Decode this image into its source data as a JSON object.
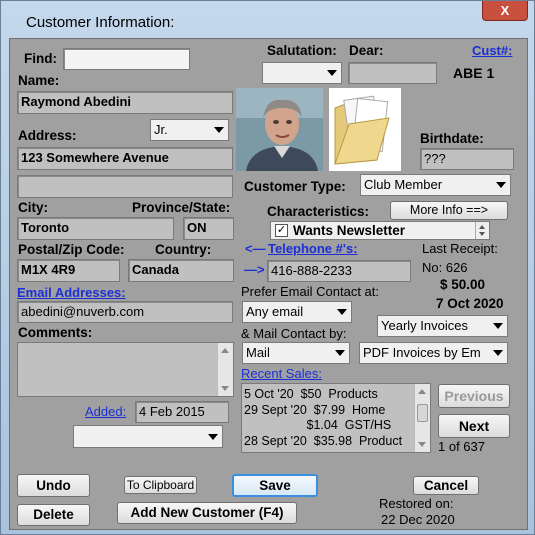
{
  "window": {
    "title": "Customer Information:",
    "close_glyph": "X"
  },
  "find": {
    "label": "Find:",
    "value": ""
  },
  "salutation": {
    "label": "Salutation:",
    "value": ""
  },
  "dear": {
    "label": "Dear:",
    "value": ""
  },
  "cust": {
    "link": "Cust#:",
    "value": "ABE  1"
  },
  "name": {
    "label": "Name:",
    "value": "Raymond Abedini"
  },
  "suffix": {
    "value": "Jr."
  },
  "address": {
    "label": "Address:",
    "line1": "123 Somewhere Avenue",
    "line2": ""
  },
  "birthdate": {
    "label": "Birthdate:",
    "value": "???"
  },
  "customer_type": {
    "label": "Customer Type:",
    "value": "Club Member"
  },
  "city": {
    "label": "City:",
    "value": "Toronto"
  },
  "province": {
    "label": "Province/State:",
    "value": "ON"
  },
  "characteristics": {
    "label": "Characteristics:",
    "more_info": "More Info ==>",
    "wants_newsletter": "Wants Newsletter",
    "checked": "✓"
  },
  "postal": {
    "label": "Postal/Zip Code:",
    "value": "M1X 4R9"
  },
  "country": {
    "label": "Country:",
    "value": "Canada"
  },
  "telephone": {
    "prev_arrow": "<—",
    "next_arrow": "—>",
    "link": "Telephone #'s:",
    "value": "416-888-2233"
  },
  "last_receipt": {
    "label": "Last Receipt:",
    "number": "No: 626",
    "amount": "$ 50.00",
    "date": "7 Oct 2020"
  },
  "email": {
    "link": "Email Addresses:",
    "value": "abedini@nuverb.com"
  },
  "email_contact": {
    "label": "Prefer Email Contact at:",
    "value": "Any email"
  },
  "invoices": {
    "value": "Yearly Invoices"
  },
  "comments": {
    "label": "Comments:",
    "value": ""
  },
  "mail_contact": {
    "label": "& Mail Contact by:",
    "value": "Mail",
    "invoice_format": "PDF Invoices by Em"
  },
  "recent_sales": {
    "link": "Recent Sales:",
    "lines": [
      "5 Oct '20  $50  Products",
      "29 Sept '20  $7.99  Home",
      "                  $1.04  GST/HS",
      "28 Sept '20  $35.98  Product"
    ]
  },
  "added": {
    "link": "Added:",
    "value": "4 Feb 2015",
    "combo": ""
  },
  "nav": {
    "previous": "Previous",
    "next": "Next",
    "position": "1 of 637"
  },
  "buttons": {
    "undo": "Undo",
    "to_clipboard": "To Clipboard",
    "save": "Save",
    "cancel": "Cancel",
    "delete": "Delete",
    "add_new": "Add New Customer (F4)"
  },
  "restored": {
    "label": "Restored on:",
    "date": "22 Dec 2020"
  }
}
